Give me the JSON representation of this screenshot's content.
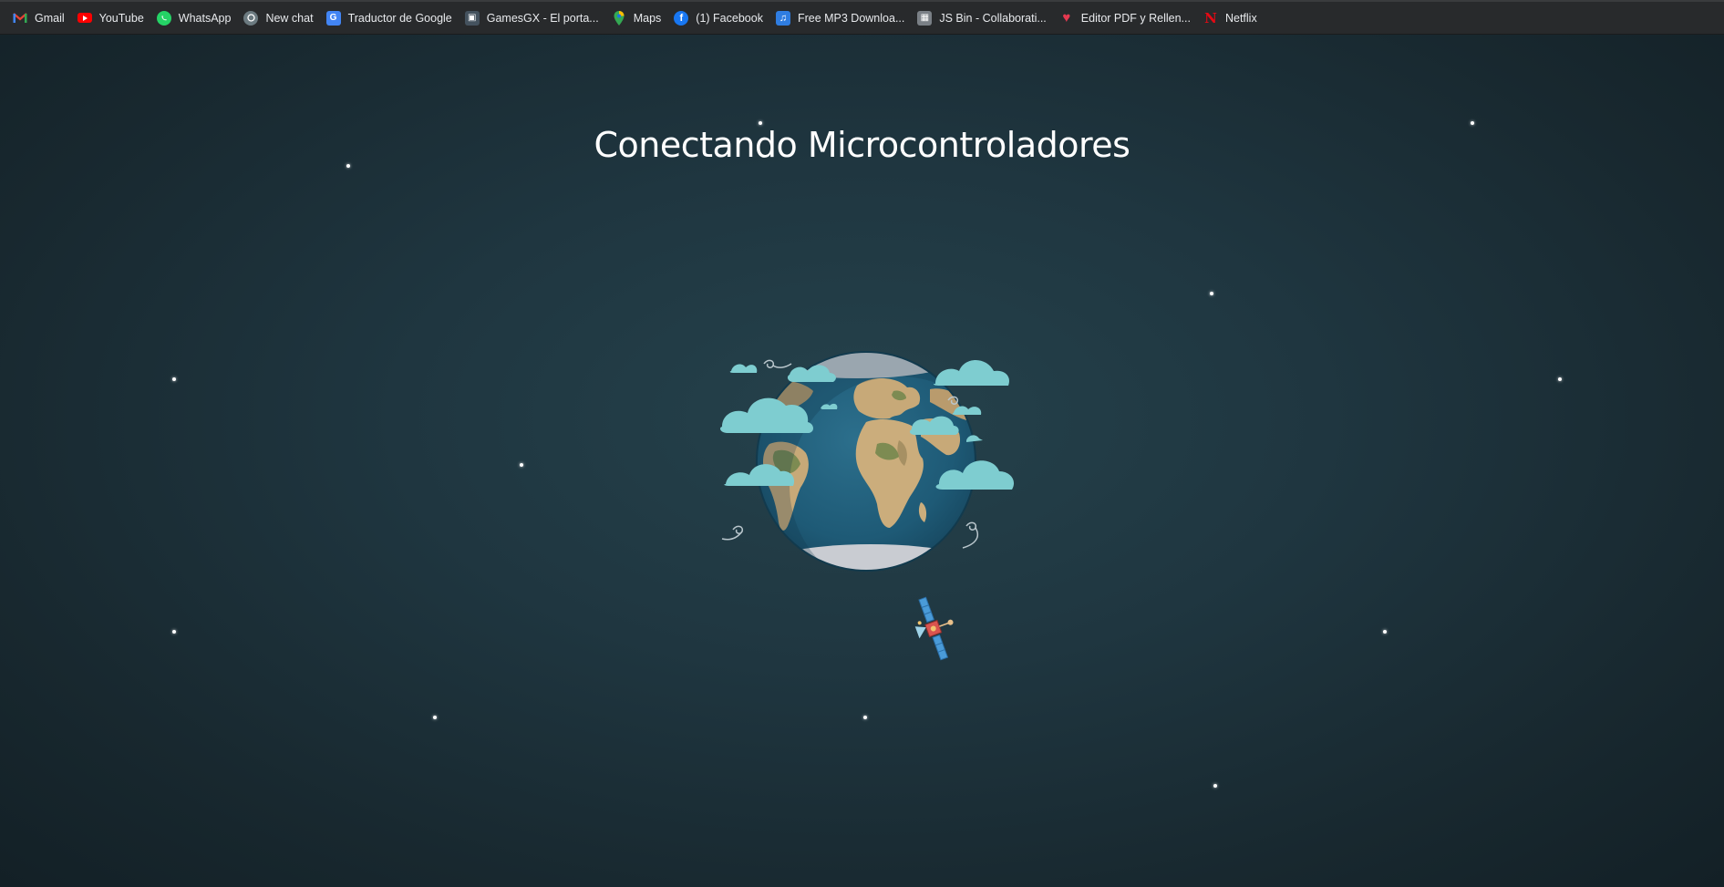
{
  "bookmarks": [
    {
      "label": "Gmail",
      "icon": "gmail-icon",
      "color": "#ea4335"
    },
    {
      "label": "YouTube",
      "icon": "youtube-icon",
      "color": "#ff0000"
    },
    {
      "label": "WhatsApp",
      "icon": "whatsapp-icon",
      "color": "#25d366"
    },
    {
      "label": "New chat",
      "icon": "chatgpt-icon",
      "color": "#8e9aa0"
    },
    {
      "label": "Traductor de Google",
      "icon": "google-translate-icon",
      "color": "#4285f4"
    },
    {
      "label": "GamesGX - El porta...",
      "icon": "gamesgx-icon",
      "color": "#5b6b78"
    },
    {
      "label": "Maps",
      "icon": "maps-pin-icon",
      "color": "#34a853"
    },
    {
      "label": "(1) Facebook",
      "icon": "facebook-icon",
      "color": "#1877f2"
    },
    {
      "label": "Free MP3 Downloa...",
      "icon": "music-note-icon",
      "color": "#2f7de1"
    },
    {
      "label": "JS Bin - Collaborati...",
      "icon": "jsbin-icon",
      "color": "#8a8f94"
    },
    {
      "label": "Editor PDF y Rellen...",
      "icon": "heart-icon",
      "color": "#e53950"
    },
    {
      "label": "Netflix",
      "icon": "netflix-icon",
      "color": "#e50914"
    }
  ],
  "page": {
    "title": "Conectando Microcontroladores",
    "background": "#1f3640",
    "accent": "#7ecdd0"
  }
}
